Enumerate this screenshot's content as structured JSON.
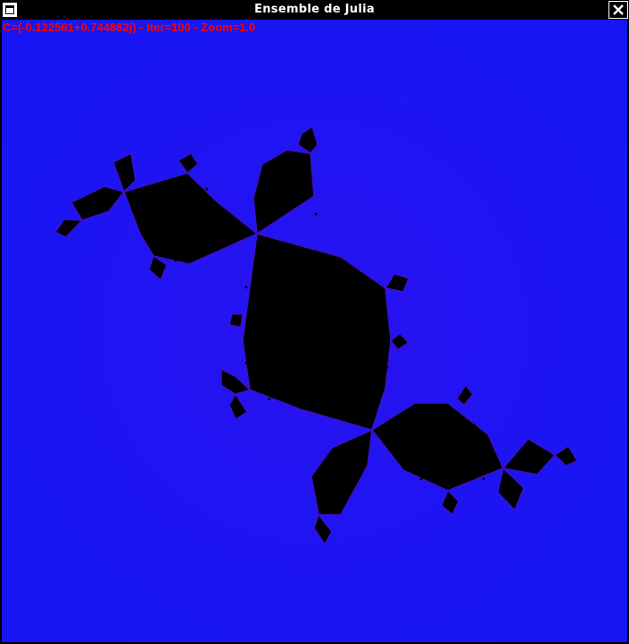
{
  "window": {
    "title": "Ensemble de Julia",
    "menu_icon": "window-menu-icon",
    "close_icon": "close-icon"
  },
  "hud": {
    "text": "C=(-0.122561+0.744862j) - Iter=100 - Zoom=1.0"
  },
  "colors": {
    "background": "#1616f4",
    "fractal": "#000000",
    "hud_text": "#ff0000",
    "titlebar": "#000000"
  }
}
